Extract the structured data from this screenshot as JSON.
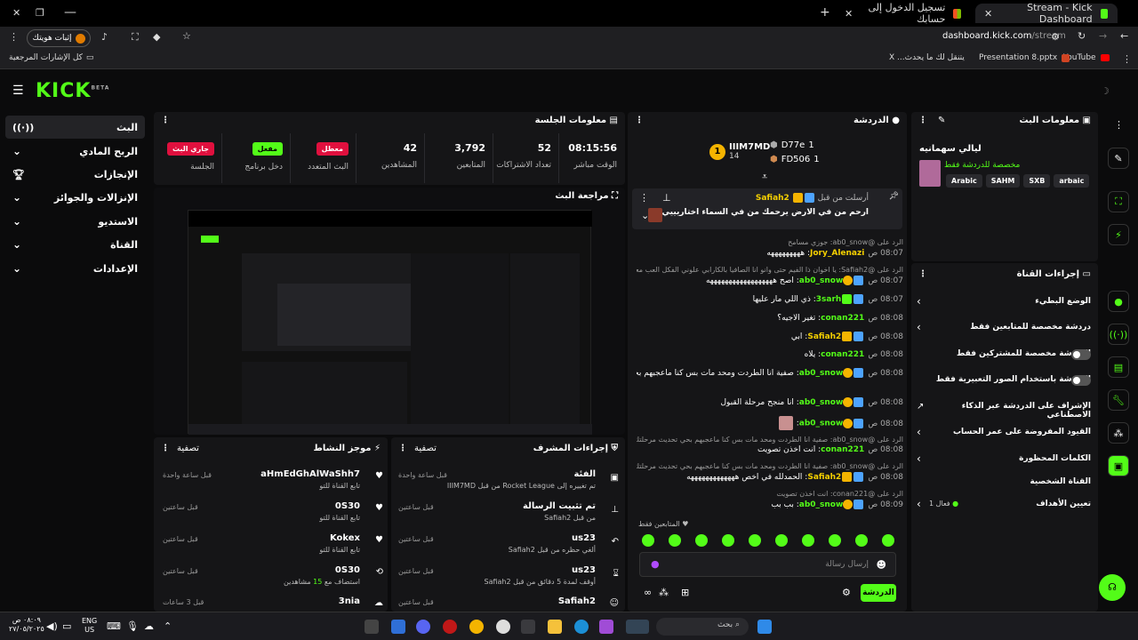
{
  "browser": {
    "tabs": [
      {
        "title": "Stream - Kick Dashboard",
        "active": true
      },
      {
        "title": "تسجيل الدخول إلى حسابك",
        "active": false
      }
    ],
    "url_host": "dashboard.kick.com",
    "url_path": "/stream",
    "profile_label": "إثبات هويتك",
    "bookmarks": [
      "YouTube",
      "Presentation 8.pptx",
      "يتنقل لك ما يحدث... X",
      "كل الإشارات المرجعية"
    ]
  },
  "brand": {
    "logo": "KICK",
    "tag": "BETA",
    "accent": "#53fc18"
  },
  "sidebar": {
    "items": [
      {
        "label": "البث",
        "icon": "broadcast-icon"
      },
      {
        "label": "الربح المادي",
        "icon": "chevron-down-icon"
      },
      {
        "label": "الإنجازات",
        "icon": "trophy-icon"
      },
      {
        "label": "الإنزالات والجوائز",
        "icon": "chevron-down-icon"
      },
      {
        "label": "الاستديو",
        "icon": "chevron-down-icon"
      },
      {
        "label": "القناة",
        "icon": "chevron-down-icon"
      },
      {
        "label": "الإعدادات",
        "icon": "chevron-down-icon"
      }
    ]
  },
  "session": {
    "title": "معلومات الجلسة",
    "stats": [
      {
        "value": "08:15:56",
        "label": "الوقت مباشر"
      },
      {
        "value": "52",
        "label": "تعداد الاشتراكات"
      },
      {
        "value": "3,792",
        "label": "المتابعين"
      },
      {
        "value": "42",
        "label": "المشاهدين"
      },
      {
        "badge": "معطل",
        "label": "البث المتعدد"
      },
      {
        "badge": "مفعل",
        "label": "دخل برنامج"
      },
      {
        "badge": "جاري البث",
        "label": "الجلسة"
      }
    ]
  },
  "preview": {
    "title": "مراجعة البث"
  },
  "activity": {
    "title": "موجز النشاط",
    "filter": "تصفية",
    "items": [
      {
        "user": "aHmEdGhAlWaShh7",
        "desc": "تابع القناة للتو",
        "time": "قبل ساعة واحدة",
        "icon": "heart-icon"
      },
      {
        "user": "0S30",
        "desc": "تابع القناة للتو",
        "time": "قبل ساعتين",
        "icon": "heart-icon"
      },
      {
        "user": "Kokex",
        "desc": "تابع القناة للتو",
        "time": "قبل ساعتين",
        "icon": "heart-icon"
      },
      {
        "user": "0S30",
        "desc_prefix": "استضاف مع",
        "desc_num": "15",
        "desc_suffix": "مشاهدين",
        "time": "قبل ساعتين",
        "icon": "host-icon"
      },
      {
        "user": "3nia",
        "desc": "",
        "time": "قبل 3 ساعات",
        "icon": "heart-icon"
      }
    ]
  },
  "modactions": {
    "title": "إجراءات المشرف",
    "filter": "تصفية",
    "items": [
      {
        "title": "الفئة",
        "line": "تم تغييره إلى Rocket League من قبل IIIM7MD",
        "time": "قبل ساعة واحدة",
        "icon": "category-icon"
      },
      {
        "title": "تم تثبيت الرسالة",
        "line": "من قبل Safiah2",
        "time": "قبل ساعتين",
        "icon": "pin-icon"
      },
      {
        "title": "us23",
        "line": "ألغي حظره من قبل Safiah2",
        "time": "قبل ساعتين",
        "icon": "undo-icon"
      },
      {
        "title": "us23",
        "line": "أوقف لمدة 5 دقائق من قبل Safiah2",
        "time": "قبل ساعتين",
        "icon": "timer-icon"
      },
      {
        "title": "Safiah2",
        "line": "",
        "time": "قبل ساعتين",
        "icon": "user-icon"
      }
    ]
  },
  "chat": {
    "title": "الدردشة",
    "leaders": [
      {
        "name": "IIIM7MD",
        "points": "14",
        "rank": "1"
      },
      {
        "name": "D77e",
        "points": "1"
      },
      {
        "name": "FD506",
        "points": "1"
      }
    ],
    "pinned": {
      "by_label": "أرسلت من قبل",
      "by": "Safiah2",
      "text": "ارحم من في الارض يرحمك من في السماء اختاريييي"
    },
    "messages": [
      {
        "reply": "الرد على @ab0_snow: جوزي مسامح",
        "time": "08:07 ص",
        "user": "Jory_Alenazi",
        "text": "هههههههههه",
        "color": "#f5d000"
      },
      {
        "reply": "الرد على @Safiah2: يا اخوان ذا الفيم حتى وانو انا الصافيا بالكارابي علوني الفكل العب معكم سوو مجانين",
        "time": "08:07 ص",
        "user": "ab0_snow",
        "text": "اصح ههههههههههههههههههه",
        "color": "#53fc18"
      },
      {
        "time": "08:07 ص",
        "user": "3sarh",
        "text": "ذي اللي مار عليها",
        "color": "#53fc18"
      },
      {
        "time": "08:08 ص",
        "user": "conan221",
        "text": "تغير الاجيه؟",
        "color": "#53fc18"
      },
      {
        "time": "08:08 ص",
        "user": "Safiah2",
        "text": "ابي",
        "color": "#f5d000"
      },
      {
        "time": "08:08 ص",
        "user": "conan221",
        "text": "يلاه",
        "color": "#53fc18"
      },
      {
        "time": "08:08 ص",
        "user": "ab0_snow",
        "text": "صفية انا الطردت ومحد مات بس كنا ماعجبهم بحي تحديث مرحلتك",
        "color": "#53fc18"
      },
      {
        "time": "08:08 ص",
        "user": "ab0_snow",
        "text": "انا منجح مرحلة القبول",
        "color": "#53fc18"
      },
      {
        "time": "08:08 ص",
        "user": "ab0_snow",
        "text": "",
        "color": "#53fc18"
      },
      {
        "reply": "الرد على @ab0_snow: صفية انا الطردت ومحد مات بس كنا ماعجبهم بحي تحديث مرحلتك",
        "time": "08:08 ص",
        "user": "conan221",
        "text": "انت اخذن تصويت",
        "color": "#53fc18"
      },
      {
        "reply": "الرد على @ab0_snow: صفية انا الطردت ومحد مات بس كنا ماعجبهم بحي تحديث مرحلتك",
        "time": "08:08 ص",
        "user": "Safiah2",
        "text": "الحمدلله في اخص هههههههههههههه",
        "color": "#f5d000"
      },
      {
        "reply": "الرد على @conan221: انت اخذن تصويت",
        "time": "08:09 ص",
        "user": "ab0_snow",
        "text": "بب بب",
        "color": "#53fc18"
      }
    ],
    "mode_note": "المتابعين فقط",
    "input_placeholder": "إرسال رسالة",
    "send_label": "الدردشة"
  },
  "streaminfo": {
    "title": "معلومات البث",
    "stream_title": "ليالي سهمانيه",
    "subtitle": "مخصصة للدردشة فقط",
    "tags": [
      "Arabic",
      "SAHM",
      "SXB",
      "arbaic"
    ]
  },
  "channelactions": {
    "title": "إجراءات القناة",
    "items": [
      {
        "label": "الوضع البطيء",
        "control": "chevron"
      },
      {
        "label": "دردشة مخصصة للمتابعين فقط",
        "control": "chevron"
      },
      {
        "label": "الدردشة مخصصة للمشتركين فقط",
        "control": "toggle"
      },
      {
        "label": "الدردشة باستخدام الصور التعبيرية فقط",
        "control": "toggle"
      },
      {
        "label": "الإشراف على الدردشة عبر الذكاء الاصطناعي",
        "control": "external"
      },
      {
        "label": "القيود المفروضة على عمر الحساب",
        "control": "chevron"
      },
      {
        "label": "الكلمات المحظورة",
        "control": "chevron"
      }
    ],
    "section": "القناة الشخصية",
    "goals_label": "تعيين الأهداف",
    "goals_value": "فعال 1"
  },
  "taskbar": {
    "search": "بحث",
    "lang": "ENG",
    "region": "US",
    "time": "٠٨:٠٩ ص",
    "date": "٢٧/٠٥/٢٠٢٥"
  }
}
